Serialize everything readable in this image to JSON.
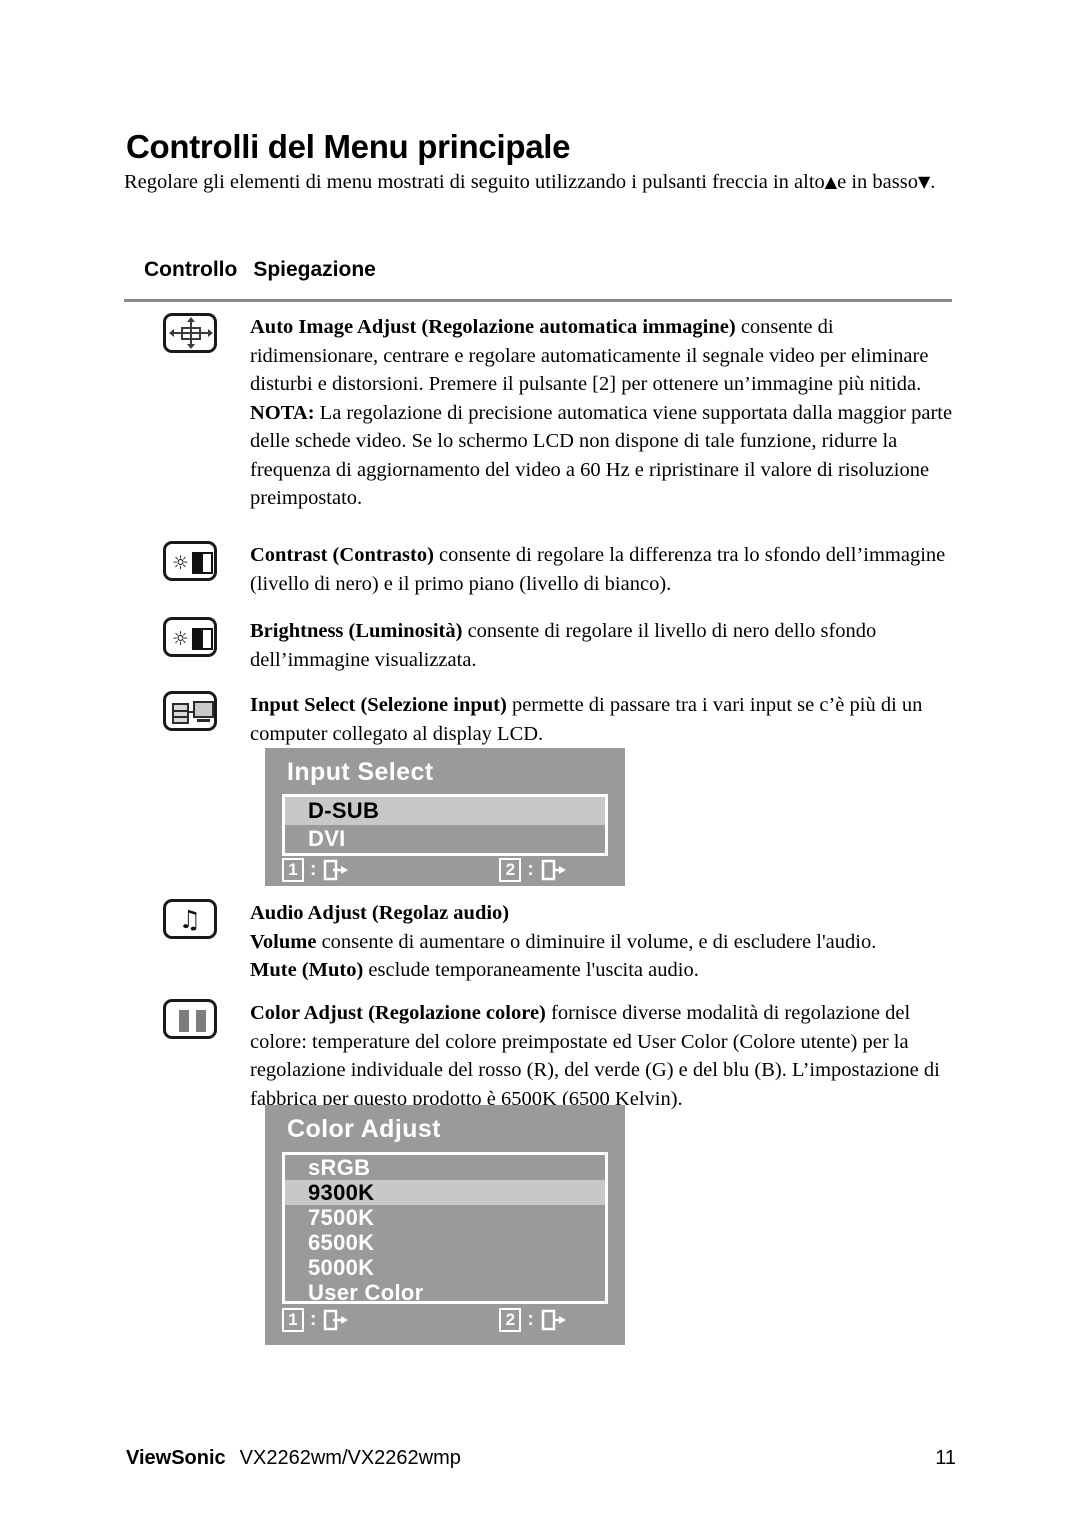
{
  "document": {
    "title": "Controlli del Menu principale",
    "intro_before": "Regolare gli elementi di menu mostrati di seguito utilizzando i pulsanti freccia in alto",
    "intro_up_arrow": "▲",
    "intro_middle": "e in basso",
    "intro_down_arrow": "▼",
    "intro_after": ".",
    "column_header_control": "Controllo",
    "column_header_explanation": "Spiegazione"
  },
  "rows": [
    {
      "icon": "auto-image-adjust-icon",
      "paragraphs": [
        {
          "bold": "Auto Image Adjust (Regolazione automatica immagine)",
          "rest": " consente di ridimensionare, centrare e regolare automaticamente il segnale video per eliminare disturbi e distorsioni. Premere il pulsante [2] per ottenere un’immagine più nitida."
        },
        {
          "bold": "NOTA:",
          "rest": " La regolazione di precisione automatica viene supportata dalla maggior parte delle schede video. Se lo schermo LCD non dispone di tale funzione, ridurre la frequenza di aggiornamento del video a 60 Hz e ripristinare il valore di risoluzione preimpostato."
        }
      ]
    },
    {
      "icon": "contrast-icon",
      "paragraphs": [
        {
          "bold": "Contrast (Contrasto)",
          "rest": " consente di regolare la differenza tra lo sfondo dell’immagine (livello di nero) e il primo piano (livello di bianco)."
        }
      ]
    },
    {
      "icon": "brightness-icon",
      "paragraphs": [
        {
          "bold": "Brightness (Luminosità)",
          "rest": " consente di regolare il livello di nero dello sfondo dell’immagine visualizzata."
        }
      ]
    },
    {
      "icon": "input-select-icon",
      "paragraphs": [
        {
          "bold": "Input Select (Selezione input)",
          "rest": " permette di passare tra i vari input se c’è più di un computer collegato al display LCD."
        }
      ]
    },
    {
      "icon": "audio-adjust-icon",
      "paragraphs": [
        {
          "bold": "Audio Adjust (Regolaz audio)",
          "rest": ""
        },
        {
          "bold": "Volume",
          "rest": " consente di aumentare o diminuire il volume, e di escludere l'audio."
        },
        {
          "bold": "Mute (Muto)",
          "rest": " esclude temporaneamente l'uscita audio."
        }
      ]
    },
    {
      "icon": "color-adjust-icon",
      "paragraphs": [
        {
          "bold": "Color Adjust (Regolazione colore)",
          "rest": " fornisce diverse modalità di regolazione del colore: temperature del colore preimpostate ed User Color (Colore utente) per la regolazione individuale del rosso (R), del verde (G) e del blu (B). L’impostazione di fabbrica per questo prodotto è 6500K (6500 Kelvin)."
        }
      ]
    }
  ],
  "osd_input_select": {
    "title": "Input Select",
    "items": [
      {
        "label": "D-SUB",
        "selected": true
      },
      {
        "label": "DVI",
        "selected": false
      }
    ],
    "footer": {
      "key1": "1",
      "colon": ":",
      "key1_icon": "exit-icon",
      "key2": "2",
      "key2_icon": "enter-icon"
    },
    "colors": {
      "background": "#9a9a9a",
      "selected_row": "#c8c8c8",
      "border": "#ffffff",
      "text": "#ffffff",
      "selected_text": "#000000"
    }
  },
  "osd_color_adjust": {
    "title": "Color Adjust",
    "items": [
      {
        "label": "sRGB",
        "selected": false
      },
      {
        "label": "9300K",
        "selected": true
      },
      {
        "label": "7500K",
        "selected": false
      },
      {
        "label": "6500K",
        "selected": false
      },
      {
        "label": "5000K",
        "selected": false
      },
      {
        "label": "User Color",
        "selected": false
      }
    ],
    "footer": {
      "key1": "1",
      "colon": ":",
      "key1_icon": "exit-icon",
      "key2": "2",
      "key2_icon": "enter-icon"
    },
    "colors": {
      "background": "#9a9a9a",
      "selected_row": "#c8c8c8",
      "border": "#ffffff",
      "text": "#ffffff",
      "selected_text": "#000000"
    }
  },
  "footer": {
    "brand": "ViewSonic",
    "model": "VX2262wm/VX2262wmp",
    "page_number": "11"
  }
}
